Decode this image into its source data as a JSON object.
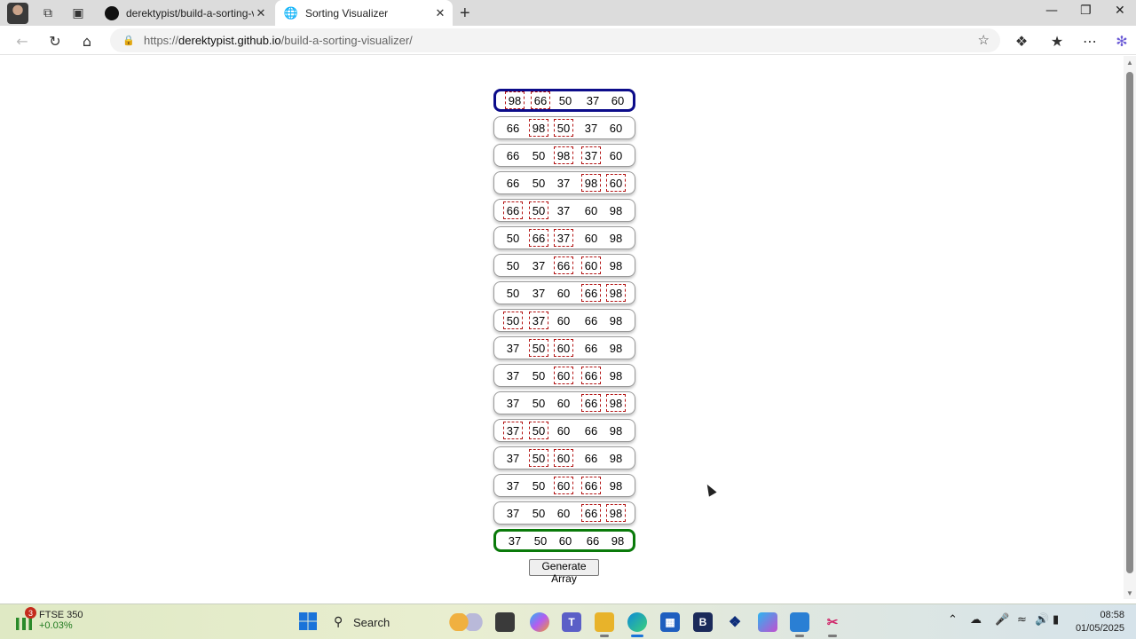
{
  "browser": {
    "tabs": [
      {
        "title": "derektypist/build-a-sorting-visual",
        "active": false,
        "favicon": "github-icon"
      },
      {
        "title": "Sorting Visualizer",
        "active": true,
        "favicon": "globe-icon"
      }
    ],
    "url_prefix": "https://",
    "url_host": "derektypist.github.io",
    "url_path": "/build-a-sorting-visualizer/"
  },
  "visualizer": {
    "rows": [
      {
        "values": [
          "98",
          "66",
          "50",
          "37",
          "60"
        ],
        "highlight": [
          0,
          1
        ],
        "kind": "start"
      },
      {
        "values": [
          "66",
          "98",
          "50",
          "37",
          "60"
        ],
        "highlight": [
          1,
          2
        ],
        "kind": "step"
      },
      {
        "values": [
          "66",
          "50",
          "98",
          "37",
          "60"
        ],
        "highlight": [
          2,
          3
        ],
        "kind": "step"
      },
      {
        "values": [
          "66",
          "50",
          "37",
          "98",
          "60"
        ],
        "highlight": [
          3,
          4
        ],
        "kind": "step"
      },
      {
        "values": [
          "66",
          "50",
          "37",
          "60",
          "98"
        ],
        "highlight": [
          0,
          1
        ],
        "kind": "step"
      },
      {
        "values": [
          "50",
          "66",
          "37",
          "60",
          "98"
        ],
        "highlight": [
          1,
          2
        ],
        "kind": "step"
      },
      {
        "values": [
          "50",
          "37",
          "66",
          "60",
          "98"
        ],
        "highlight": [
          2,
          3
        ],
        "kind": "step"
      },
      {
        "values": [
          "50",
          "37",
          "60",
          "66",
          "98"
        ],
        "highlight": [
          3,
          4
        ],
        "kind": "step"
      },
      {
        "values": [
          "50",
          "37",
          "60",
          "66",
          "98"
        ],
        "highlight": [
          0,
          1
        ],
        "kind": "step"
      },
      {
        "values": [
          "37",
          "50",
          "60",
          "66",
          "98"
        ],
        "highlight": [
          1,
          2
        ],
        "kind": "step"
      },
      {
        "values": [
          "37",
          "50",
          "60",
          "66",
          "98"
        ],
        "highlight": [
          2,
          3
        ],
        "kind": "step"
      },
      {
        "values": [
          "37",
          "50",
          "60",
          "66",
          "98"
        ],
        "highlight": [
          3,
          4
        ],
        "kind": "step"
      },
      {
        "values": [
          "37",
          "50",
          "60",
          "66",
          "98"
        ],
        "highlight": [
          0,
          1
        ],
        "kind": "step"
      },
      {
        "values": [
          "37",
          "50",
          "60",
          "66",
          "98"
        ],
        "highlight": [
          1,
          2
        ],
        "kind": "step"
      },
      {
        "values": [
          "37",
          "50",
          "60",
          "66",
          "98"
        ],
        "highlight": [
          2,
          3
        ],
        "kind": "step"
      },
      {
        "values": [
          "37",
          "50",
          "60",
          "66",
          "98"
        ],
        "highlight": [
          3,
          4
        ],
        "kind": "step"
      },
      {
        "values": [
          "37",
          "50",
          "60",
          "66",
          "98"
        ],
        "highlight": [],
        "kind": "final"
      }
    ],
    "colors": {
      "start_border": "#0c0c8a",
      "final_border": "#0a7a0a",
      "highlight": "#b31212"
    },
    "generate_label": "Generate Array"
  },
  "taskbar": {
    "widget_name": "FTSE 350",
    "widget_change": "+0.03%",
    "widget_badge": "3",
    "search_label": "Search",
    "time": "08:58",
    "date": "01/05/2025"
  }
}
